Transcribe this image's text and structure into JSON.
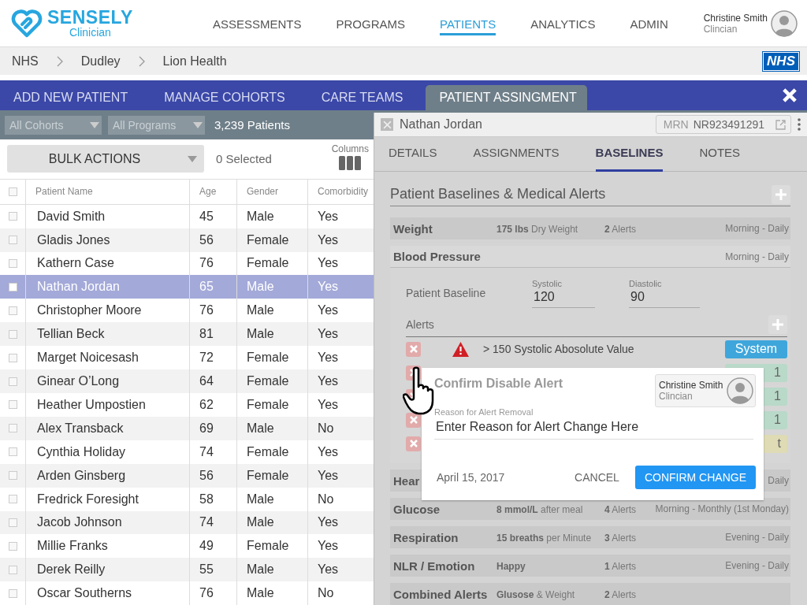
{
  "brand": {
    "name": "SENSELY",
    "sub": "Clinician"
  },
  "nav": [
    {
      "label": "ASSESSMENTS",
      "selected": false
    },
    {
      "label": "PROGRAMS",
      "selected": false
    },
    {
      "label": "PATIENTS",
      "selected": true
    },
    {
      "label": "ANALYTICS",
      "selected": false
    },
    {
      "label": "ADMIN",
      "selected": false
    }
  ],
  "user": {
    "name": "Christine Smith",
    "role": "Clincian"
  },
  "breadcrumb": [
    "NHS",
    "Dudley",
    "Lion Health"
  ],
  "org_logo": "NHS",
  "tabs": [
    {
      "label": "ADD NEW PATIENT",
      "selected": false
    },
    {
      "label": "MANAGE COHORTS",
      "selected": false
    },
    {
      "label": "CARE TEAMS",
      "selected": false
    },
    {
      "label": "PATIENT ASSINGMENT",
      "selected": true
    }
  ],
  "filters": {
    "cohort": "All Cohorts",
    "program": "All Programs",
    "count": "3,239 Patients"
  },
  "bulk": {
    "label": "BULK ACTIONS",
    "selected_count": "0 Selected",
    "columns_label": "Columns"
  },
  "table": {
    "columns": [
      "Patient Name",
      "Age",
      "Gender",
      "Comorbidity"
    ],
    "select_all_checked": false,
    "rows": [
      {
        "cells": [
          "David Smith",
          "45",
          "Male",
          "Yes"
        ],
        "selected": false,
        "checked": false
      },
      {
        "cells": [
          "Gladis Jones",
          "56",
          "Female",
          "Yes"
        ],
        "selected": false,
        "checked": false
      },
      {
        "cells": [
          "Kathern Case",
          "76",
          "Female",
          "Yes"
        ],
        "selected": false,
        "checked": false
      },
      {
        "cells": [
          "Nathan Jordan",
          "65",
          "Male",
          "Yes"
        ],
        "selected": true,
        "checked": false
      },
      {
        "cells": [
          "Christopher Moore",
          "76",
          "Male",
          "Yes"
        ],
        "selected": false,
        "checked": false
      },
      {
        "cells": [
          "Tellian Beck",
          "81",
          "Male",
          "Yes"
        ],
        "selected": false,
        "checked": false
      },
      {
        "cells": [
          "Marget Noicesash",
          "72",
          "Female",
          "Yes"
        ],
        "selected": false,
        "checked": false
      },
      {
        "cells": [
          "Ginear O’Long",
          "64",
          "Female",
          "Yes"
        ],
        "selected": false,
        "checked": false
      },
      {
        "cells": [
          "Heather Umpostien",
          "62",
          "Female",
          "Yes"
        ],
        "selected": false,
        "checked": false
      },
      {
        "cells": [
          "Alex Transback",
          "69",
          "Male",
          "No"
        ],
        "selected": false,
        "checked": false
      },
      {
        "cells": [
          "Cynthia Holiday",
          "74",
          "Female",
          "Yes"
        ],
        "selected": false,
        "checked": false
      },
      {
        "cells": [
          "Arden Ginsberg",
          "56",
          "Female",
          "Yes"
        ],
        "selected": false,
        "checked": false
      },
      {
        "cells": [
          "Fredrick Foresight",
          "58",
          "Male",
          "No"
        ],
        "selected": false,
        "checked": false
      },
      {
        "cells": [
          "Jacob Johnson",
          "74",
          "Male",
          "Yes"
        ],
        "selected": false,
        "checked": false
      },
      {
        "cells": [
          "Millie Franks",
          "49",
          "Female",
          "Yes"
        ],
        "selected": false,
        "checked": false
      },
      {
        "cells": [
          "Derek Reilly",
          "55",
          "Male",
          "Yes"
        ],
        "selected": false,
        "checked": false
      },
      {
        "cells": [
          "Oscar Southerns",
          "76",
          "Male",
          "No"
        ],
        "selected": false,
        "checked": false
      }
    ]
  },
  "detail": {
    "name": "Nathan Jordan",
    "mrn_label": "MRN",
    "mrn": "NR923491291",
    "tabs": [
      {
        "label": "DETAILS",
        "selected": false
      },
      {
        "label": "ASSIGNMENTS",
        "selected": false
      },
      {
        "label": "BASELINES",
        "selected": true
      },
      {
        "label": "NOTES",
        "selected": false
      }
    ],
    "title": "Patient Baselines & Medical Alerts",
    "vitals": [
      {
        "name": "Weight",
        "value": "**175 lbs** Dry Weight",
        "alerts": "**2**  Alerts",
        "schedule": "Morning - Daily",
        "expanded": false
      },
      {
        "name": "Blood Pressure",
        "schedule": "Morning - Daily",
        "expanded": true,
        "baseline_label": "Patient Baseline",
        "fields": [
          {
            "label": "Systolic",
            "value": "120"
          },
          {
            "label": "Diastolic",
            "value": "90"
          }
        ],
        "alerts_label": "Alerts",
        "alert_rows": [
          {
            "text": "> 150 Systolic Abosolute Value",
            "badge": "System",
            "color": "#3fa6db"
          },
          {
            "badge": "1",
            "color": "#b9d9c9"
          },
          {
            "badge": "1",
            "color": "#b9d9c9"
          },
          {
            "badge": "1",
            "color": "#b9d9c9"
          },
          {
            "badge": "t",
            "color": "#dedbb5"
          }
        ]
      },
      {
        "name": "Hear",
        "schedule": "Daily",
        "expanded": false
      },
      {
        "name": "Glucose",
        "value": "**8 mmol/L** after meal",
        "alerts": "**4** Alerts",
        "schedule": "Morning - Monthly (1st Monday)",
        "expanded": false
      },
      {
        "name": "Respiration",
        "value": "**15 breaths** per Minute",
        "alerts": "**3** Alerts",
        "schedule": "Evening - Daily",
        "expanded": false
      },
      {
        "name": "NLR / Emotion",
        "value": "**Happy**",
        "alerts": "**1** Alerts",
        "schedule": "Evening - Daily",
        "expanded": false
      },
      {
        "name": "Combined Alerts",
        "value": "**Glusose** & Weight",
        "alerts": "**2** Alerts",
        "expanded": false
      }
    ]
  },
  "dialog": {
    "title": "Confirm Disable Alert",
    "user": {
      "name": "Christine Smith",
      "role": "Clincian"
    },
    "field_label": "Reason for Alert Removal",
    "placeholder": "Enter Reason for Alert Change Here",
    "date": "April 15, 2017",
    "cancel": "CANCEL",
    "confirm": "CONFIRM CHANGE"
  }
}
